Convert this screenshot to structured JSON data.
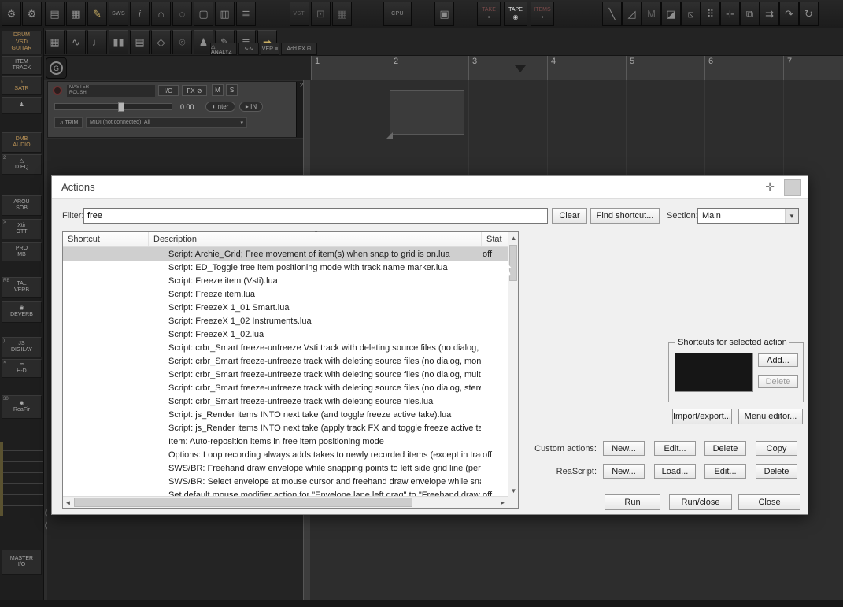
{
  "colors": {
    "accent_yellow": "#c9ae62",
    "dialog_bg": "#f0f0f0",
    "selection_gray": "#cfcfcf",
    "dark_bg": "#2d2d2d"
  },
  "toolbar1": {
    "left_icons": [
      {
        "name": "mouse-modifier-icon",
        "glyph": "⚙"
      },
      {
        "name": "gear-icon",
        "glyph": "⚙"
      }
    ],
    "main_icons": [
      {
        "name": "save-icon",
        "glyph": "▤"
      },
      {
        "name": "trash-icon",
        "glyph": "▦"
      },
      {
        "name": "pencil-icon",
        "glyph": "✎",
        "accent": true
      },
      {
        "name": "sws-icon",
        "glyph": "SWS",
        "text": true
      },
      {
        "name": "info-icon",
        "glyph": "i",
        "circle": true
      },
      {
        "name": "home-icon",
        "glyph": "⌂"
      },
      {
        "name": "search-icon",
        "glyph": "◌"
      },
      {
        "name": "screenset-icon",
        "glyph": "▢"
      },
      {
        "name": "docker-icon",
        "glyph": "▥"
      },
      {
        "name": "mixer-icon",
        "glyph": "≣"
      }
    ],
    "plugin_icons": [
      {
        "name": "vsti-icon",
        "glyph": "VSTi",
        "text": true,
        "dim": true
      },
      {
        "name": "plugin-slot-icon",
        "glyph": "⊡",
        "dim": true
      },
      {
        "name": "routing-grid-icon",
        "glyph": "▦",
        "dim": true
      }
    ],
    "cpu_label": "CPU",
    "monitor_icon": "▣",
    "word_buttons": [
      {
        "name": "take-button",
        "label": "TAKE",
        "sub": "◦"
      },
      {
        "name": "tape-button",
        "label": "TAPE",
        "sub": "◉",
        "active": true
      },
      {
        "name": "items-button",
        "label": "ITEMS",
        "sub": "◦"
      }
    ],
    "right_icons": [
      {
        "name": "razor-edit-icon",
        "glyph": "╲"
      },
      {
        "name": "slope-edit-icon",
        "glyph": "◿"
      },
      {
        "name": "marker-m-icon",
        "glyph": "M",
        "dim": true
      },
      {
        "name": "marker-m2-icon",
        "glyph": "◪"
      },
      {
        "name": "fade-tool-icon",
        "glyph": "⧅"
      },
      {
        "name": "grid-dots-icon",
        "glyph": "⠿"
      },
      {
        "name": "crosshair-icon",
        "glyph": "⊹"
      },
      {
        "name": "duplicate-icon",
        "glyph": "⧉"
      },
      {
        "name": "routing-icon",
        "glyph": "⇉"
      },
      {
        "name": "loop-icon",
        "glyph": "↷"
      },
      {
        "name": "sync-icon",
        "glyph": "↻"
      }
    ]
  },
  "toolbar2": {
    "icons": [
      {
        "name": "drum-machine-icon",
        "glyph": "▦"
      },
      {
        "name": "tempo-wave-icon",
        "glyph": "∿"
      },
      {
        "name": "guitar-icon",
        "glyph": "♩"
      },
      {
        "name": "meter-bars-icon",
        "glyph": "▮▮"
      },
      {
        "name": "piano-keys-icon",
        "glyph": "▤"
      },
      {
        "name": "percussion-icon",
        "glyph": "◇"
      },
      {
        "name": "mic-icon",
        "glyph": "⌾"
      },
      {
        "name": "artist-icon",
        "glyph": "♟"
      },
      {
        "name": "draw-brush-icon",
        "glyph": "✎"
      },
      {
        "name": "levels-icon",
        "glyph": "≣"
      },
      {
        "name": "arrow-icon",
        "glyph": "➡",
        "accent": true
      }
    ],
    "minis": [
      {
        "name": "analyze-button",
        "label": "△ ANALYZ"
      },
      {
        "name": "wave-button",
        "label": "∿∿"
      },
      {
        "name": "ver-button",
        "label": "VER ≡"
      },
      {
        "name": "add-fx-button",
        "label": "Add FX ⊞"
      }
    ]
  },
  "transport": {
    "g_button": "G"
  },
  "ruler": {
    "marks": [
      "1",
      "2",
      "3",
      "4",
      "5",
      "6",
      "7"
    ]
  },
  "master": {
    "label": "MASTER",
    "sublabel": "ROUSH",
    "io": "I/O",
    "fx": "FX ⊘",
    "mute": "M",
    "solo": "S",
    "volume": "0.00",
    "pan": "◐ nter",
    "input": "▸ IN",
    "trim": "⊿ TRIM",
    "midi": "MIDI (not connected): All",
    "midi_arrow": "▾",
    "meter_num": "2"
  },
  "sidebar": {
    "items": [
      {
        "name": "fx-drum-guitar",
        "lines": [
          "DRUM",
          "VSTi",
          "GUITAR"
        ],
        "tan": true
      },
      {
        "name": "fx-item-track",
        "lines": [
          "ITEM",
          "TRACK"
        ]
      },
      {
        "name": "fx-satr",
        "lines": [
          "♪",
          "SATR"
        ],
        "tan": true
      },
      {
        "name": "fx-artist",
        "lines": [
          "♟"
        ]
      },
      {
        "name": "fx-dmb-audio",
        "lines": [
          "DMB",
          "AUDIO"
        ],
        "tan": true
      },
      {
        "name": "fx-d-eq",
        "lines": [
          "△",
          "D EQ"
        ],
        "corner": "2"
      },
      {
        "name": "fx-arou-sob",
        "lines": [
          "AROU",
          "SOB"
        ]
      },
      {
        "name": "fx-ott",
        "lines": [
          "Xtir",
          "OTT"
        ],
        "corner": ">"
      },
      {
        "name": "fx-pro-mb",
        "lines": [
          "PRO",
          "MB"
        ]
      },
      {
        "name": "fx-tal-verb",
        "lines": [
          "TAL",
          "VERB"
        ],
        "corner": "RB"
      },
      {
        "name": "fx-deverb",
        "lines": [
          "◉",
          "DEVERB"
        ]
      },
      {
        "name": "fx-js-digilay",
        "lines": [
          "JS",
          "DIGILAY"
        ],
        "corner": ")"
      },
      {
        "name": "fx-hd",
        "lines": [
          "♒",
          "H-D"
        ],
        "corner": "×"
      },
      {
        "name": "fx-reafir",
        "lines": [
          "◉",
          "ReaFir"
        ],
        "corner": "30"
      }
    ],
    "master_tile": {
      "line1": "MASTER",
      "line2": "I/O"
    }
  },
  "actions": {
    "title": "Actions",
    "pin_icon": "✛",
    "filter_label": "Filter:",
    "filter_value": "free",
    "clear_button": "Clear",
    "find_shortcut_button": "Find shortcut...",
    "section_label": "Section:",
    "section_value": "Main",
    "combo_arrow": "▼",
    "columns": {
      "shortcut": "Shortcut",
      "description": "Description",
      "state": "Stat"
    },
    "sort_indicator": "ˆ",
    "scroll": {
      "up": "▲",
      "down": "▼",
      "left": "◄",
      "right": "►"
    },
    "rows": [
      {
        "shortcut": "",
        "description": "Script: Archie_Grid;  Free movement of item(s) when snap to grid is on.lua",
        "state": "off",
        "selected": true
      },
      {
        "shortcut": "",
        "description": "Script: ED_Toggle free item positioning mode with track name marker.lua",
        "state": ""
      },
      {
        "shortcut": "",
        "description": "Script: Freeze item (Vsti).lua",
        "state": ""
      },
      {
        "shortcut": "",
        "description": "Script: Freeze item.lua",
        "state": ""
      },
      {
        "shortcut": "",
        "description": "Script: FreezeX 1_01 Smart.lua",
        "state": ""
      },
      {
        "shortcut": "",
        "description": "Script: FreezeX 1_02 Instruments.lua",
        "state": ""
      },
      {
        "shortcut": "",
        "description": "Script: FreezeX 1_02.lua",
        "state": ""
      },
      {
        "shortcut": "",
        "description": "Script: crbr_Smart freeze-unfreeze Vsti track with deleting source files (no dialog, stere...",
        "state": ""
      },
      {
        "shortcut": "",
        "description": "Script: crbr_Smart freeze-unfreeze track with deleting source files (no dialog, mono only...",
        "state": ""
      },
      {
        "shortcut": "",
        "description": "Script: crbr_Smart freeze-unfreeze track with deleting source files (no dialog, multi only)...",
        "state": ""
      },
      {
        "shortcut": "",
        "description": "Script: crbr_Smart freeze-unfreeze track with deleting source files (no dialog, stereo onl...",
        "state": ""
      },
      {
        "shortcut": "",
        "description": "Script: crbr_Smart freeze-unfreeze track with deleting source files.lua",
        "state": ""
      },
      {
        "shortcut": "",
        "description": "Script: js_Render items INTO next take (and toggle freeze active take).lua",
        "state": ""
      },
      {
        "shortcut": "",
        "description": "Script: js_Render items INTO next take (apply track FX and toggle freeze active take F...",
        "state": ""
      },
      {
        "shortcut": "",
        "description": "Item: Auto-reposition items in free item positioning mode",
        "state": ""
      },
      {
        "shortcut": "",
        "description": "Options: Loop recording always adds takes to newly recorded items (except in track fre...",
        "state": "off"
      },
      {
        "shortcut": "",
        "description": "SWS/BR: Freehand draw envelope while snapping points to left side grid line (perform ...",
        "state": ""
      },
      {
        "shortcut": "",
        "description": "SWS/BR: Select envelope at mouse cursor and freehand draw envelope while snappi...",
        "state": ""
      },
      {
        "shortcut": "",
        "description": "Set default mouse modifier action for \"Envelope lane left drag\" to \"Freehand draw...\"",
        "state": "off"
      }
    ],
    "shortcuts_group": {
      "title": "Shortcuts for selected action",
      "add_button": "Add...",
      "delete_button": "Delete"
    },
    "import_export_button": "Import/export...",
    "menu_editor_button": "Menu editor...",
    "custom_actions_label": "Custom actions:",
    "custom_buttons": {
      "new": "New...",
      "edit": "Edit...",
      "delete": "Delete",
      "copy": "Copy"
    },
    "reascript_label": "ReaScript:",
    "reascript_buttons": {
      "new": "New...",
      "load": "Load...",
      "edit": "Edit...",
      "delete": "Delete"
    },
    "run_button": "Run",
    "run_close_button": "Run/close",
    "close_button": "Close"
  }
}
